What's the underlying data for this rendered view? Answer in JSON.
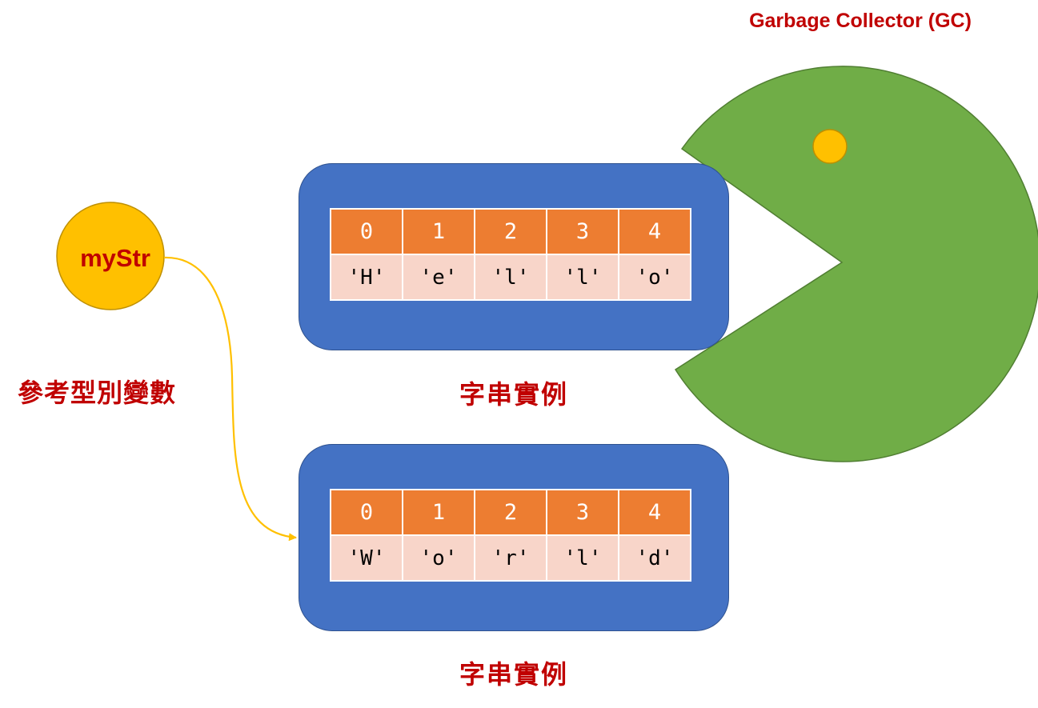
{
  "gc_label": "Garbage Collector (GC)",
  "variable": {
    "name": "myStr",
    "label": "參考型別變數"
  },
  "instances": [
    {
      "label": "字串實例",
      "indices": [
        "0",
        "1",
        "2",
        "3",
        "4"
      ],
      "values": [
        "'H'",
        "'e'",
        "'l'",
        "'l'",
        "'o'"
      ]
    },
    {
      "label": "字串實例",
      "indices": [
        "0",
        "1",
        "2",
        "3",
        "4"
      ],
      "values": [
        "'W'",
        "'o'",
        "'r'",
        "'l'",
        "'d'"
      ]
    }
  ],
  "colors": {
    "pacman": "#70ad47",
    "pacman_eye": "#ffc000",
    "variable_circle": "#ffc000",
    "block": "#4472c4",
    "index_cell": "#ed7d31",
    "value_cell": "#f8d5c9",
    "label_text": "#c00000",
    "reference_arrow": "#ffc000"
  }
}
